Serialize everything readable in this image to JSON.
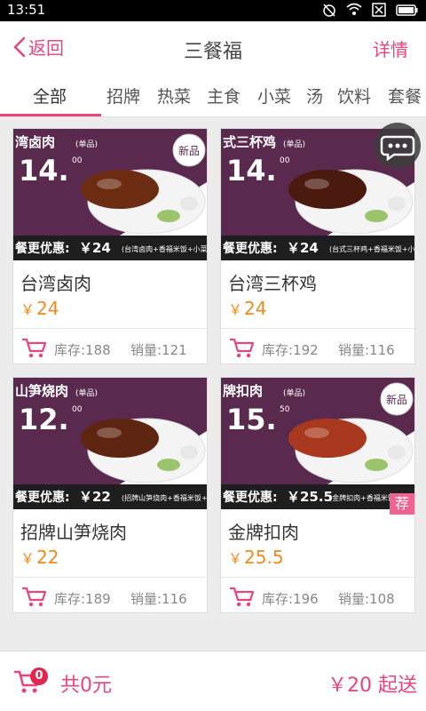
{
  "status": {
    "time": "13:51"
  },
  "header": {
    "back_label": "返回",
    "title": "三餐福",
    "detail_label": "详情"
  },
  "tabs": [
    "全部",
    "招牌",
    "热菜",
    "主食",
    "小菜",
    "汤",
    "饮料",
    "套餐"
  ],
  "active_tab": 0,
  "products": [
    {
      "name": "台湾卤肉",
      "currency": "￥",
      "price": "24",
      "stock": "库存:188",
      "sales": "销量:121",
      "banner_title": "湾卤肉",
      "banner_tag": "(单品)",
      "banner_price_int": "14.",
      "banner_price_dec": "00",
      "banner_new": "新品",
      "promo_label": "餐更优惠:",
      "promo_price": "￥24",
      "promo_detail": "(台湾卤肉+香福米饭+小菜+汤",
      "recommended": false
    },
    {
      "name": "台湾三杯鸡",
      "currency": "￥",
      "price": "24",
      "stock": "库存:192",
      "sales": "销量:116",
      "banner_title": "式三杯鸡",
      "banner_tag": "(单品)",
      "banner_price_int": "14.",
      "banner_price_dec": "00",
      "banner_new": "",
      "promo_label": "餐更优惠:",
      "promo_price": "￥24",
      "promo_detail": "(台式三杯鸡+香福米饭+小菜+",
      "recommended": false
    },
    {
      "name": "招牌山笋烧肉",
      "currency": "￥",
      "price": "22",
      "stock": "库存:189",
      "sales": "销量:116",
      "banner_title": "山笋烧肉",
      "banner_tag": "(单品)",
      "banner_price_int": "12.",
      "banner_price_dec": "00",
      "banner_new": "",
      "promo_label": "餐更优惠:",
      "promo_price": "￥22",
      "promo_detail": "(招牌山笋烧肉+香福米饭+小菜+汤",
      "recommended": false
    },
    {
      "name": "金牌扣肉",
      "currency": "￥",
      "price": "25.5",
      "stock": "库存:196",
      "sales": "销量:108",
      "banner_title": "牌扣肉",
      "banner_tag": "(单品)",
      "banner_price_int": "15.",
      "banner_price_dec": "50",
      "banner_new": "新品",
      "promo_label": "餐更优惠:",
      "promo_price": "￥25.5",
      "promo_detail": "(金牌扣肉+香福米饭+小菜+",
      "recommended": true,
      "recommended_label": "荐"
    }
  ],
  "cart": {
    "count": "0",
    "total_label": "共0元",
    "min_order": "￥20 起送"
  },
  "colors": {
    "accent": "#e8457b",
    "price": "#f08a1c",
    "banner": "#5a2a4e"
  }
}
